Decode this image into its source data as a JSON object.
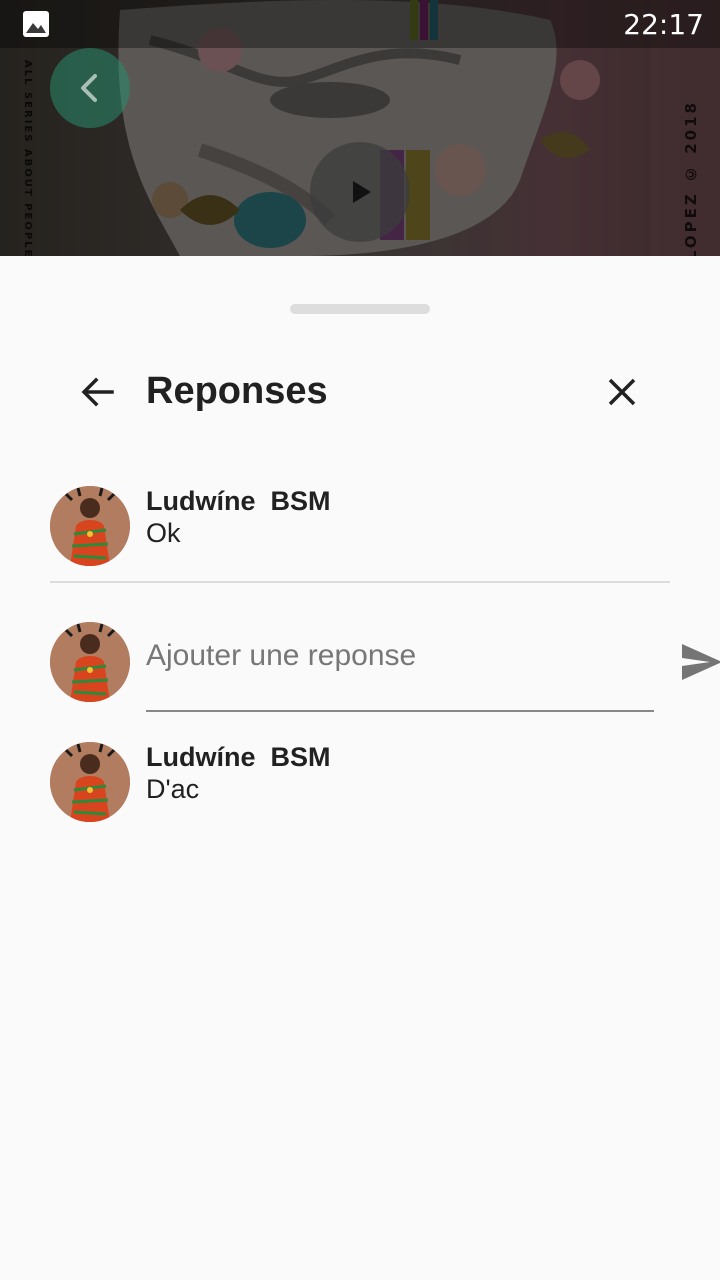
{
  "status_bar": {
    "time": "22:17",
    "notification_icon": "image-icon"
  },
  "video": {
    "side_text_left": "ALL SERIES ABOUT PEOPLE AR",
    "side_text_right": "LOPEZ © 2018",
    "back_icon": "chevron-left-icon",
    "play_icon": "play-icon"
  },
  "sheet": {
    "title": "Reponses",
    "back_icon": "arrow-left-icon",
    "close_icon": "close-icon"
  },
  "replies": [
    {
      "author": "Ludwíne  BSM",
      "text": "Ok"
    },
    {
      "author": "Ludwíne  BSM",
      "text": "D'ac"
    }
  ],
  "compose": {
    "placeholder": "Ajouter une reponse",
    "value": "",
    "send_icon": "send-icon"
  },
  "colors": {
    "accent_green": "#2c8c6e",
    "text": "#212121",
    "placeholder": "#777777"
  }
}
